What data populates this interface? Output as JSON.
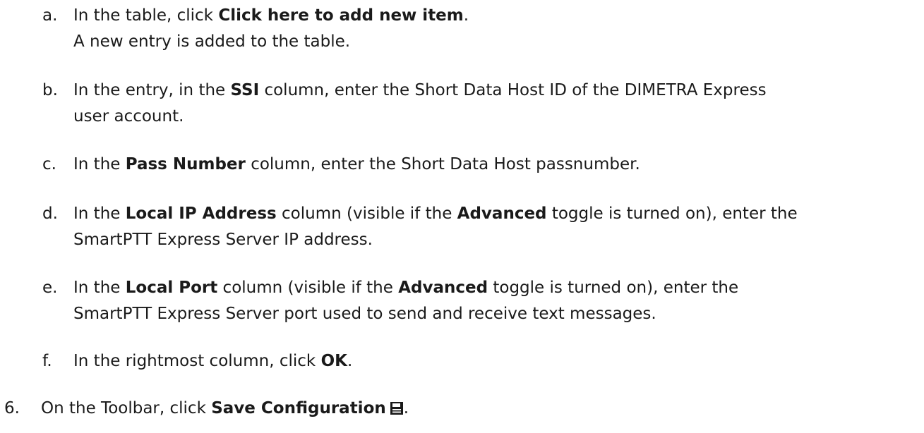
{
  "substeps": {
    "a": {
      "marker": "a.",
      "pre": "In the table, click ",
      "bold": "Click here to add new item",
      "post": ".",
      "result": "A new entry is added to the table."
    },
    "b": {
      "marker": "b.",
      "pre": "In the entry, in the ",
      "bold": "SSI",
      "post": " column, enter the Short Data Host ID of the DIMETRA Express",
      "cont": "user account."
    },
    "c": {
      "marker": "c.",
      "pre": "In the ",
      "bold": "Pass Number",
      "post": " column, enter the Short Data Host passnumber."
    },
    "d": {
      "marker": "d.",
      "pre": "In the ",
      "bold": "Local IP Address",
      "mid": " column (visible if the ",
      "bold2": "Advanced",
      "post": " toggle is turned on), enter the",
      "cont": "SmartPTT Express Server IP address."
    },
    "e": {
      "marker": "e.",
      "pre": "In the ",
      "bold": "Local Port",
      "mid": " column (visible if the ",
      "bold2": "Advanced",
      "post": " toggle is turned on), enter the",
      "cont": "SmartPTT Express Server port used to send and receive text messages."
    },
    "f": {
      "marker": "f.",
      "pre": "In the rightmost column, click ",
      "bold": "OK",
      "post": "."
    }
  },
  "step6": {
    "marker": "6.",
    "pre": "On the Toolbar, click ",
    "bold": "Save Configuration",
    "icon": "save-icon",
    "post": "."
  }
}
